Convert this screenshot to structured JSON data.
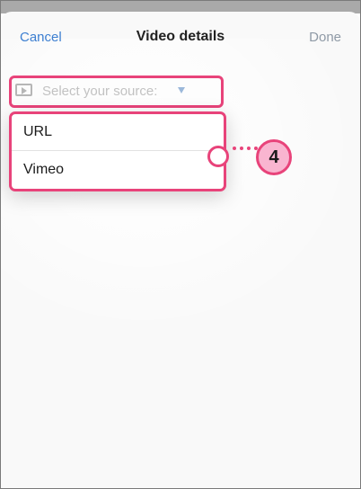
{
  "header": {
    "cancel_label": "Cancel",
    "title": "Video details",
    "done_label": "Done"
  },
  "source_select": {
    "placeholder": "Select your source:",
    "icon": "play-icon"
  },
  "source_options": [
    {
      "label": "URL"
    },
    {
      "label": "Vimeo"
    }
  ],
  "annotation": {
    "step_number": "4"
  },
  "colors": {
    "accent_link": "#3d7fd1",
    "done_disabled": "#8f9aa6",
    "highlight": "#e8437a",
    "badge_fill": "#f9b5d0",
    "placeholder_text": "#c2c2c2"
  }
}
